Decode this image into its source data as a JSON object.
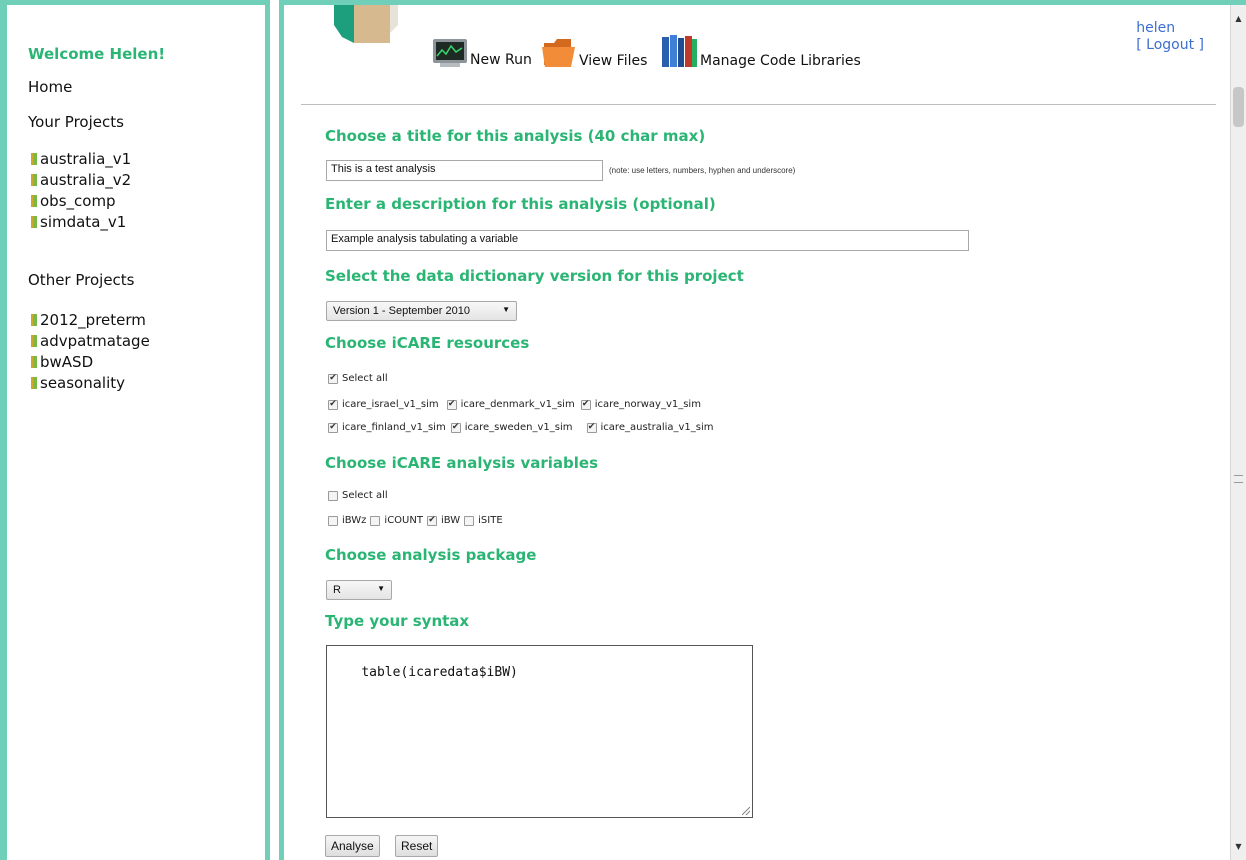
{
  "sidebar": {
    "welcome": "Welcome Helen!",
    "home": "Home",
    "your_projects_heading": "Your Projects",
    "your_projects": [
      "australia_v1",
      "australia_v2",
      "obs_comp",
      "simdata_v1"
    ],
    "other_projects_heading": "Other Projects",
    "other_projects": [
      "2012_preterm",
      "advpatmatage",
      "bwASD",
      "seasonality"
    ]
  },
  "toolbar": {
    "new_run": "New Run",
    "view_files": "View Files",
    "manage_code_libraries": "Manage Code Libraries"
  },
  "user": {
    "name": "helen",
    "logout": "[ Logout ]"
  },
  "form": {
    "title_heading": "Choose a title for this analysis (40 char max)",
    "title_value": "This is a test analysis",
    "title_note": "(note: use letters, numbers, hyphen and underscore)",
    "description_heading": "Enter a description for this analysis (optional)",
    "description_value": "Example analysis tabulating a variable",
    "dictionary_heading": "Select the data dictionary version for this project",
    "dictionary_value": "Version 1 - September 2010",
    "resources_heading": "Choose iCARE resources",
    "resources_select_all": {
      "label": "Select all",
      "checked": true
    },
    "resources": [
      {
        "label": "icare_israel_v1_sim",
        "checked": true
      },
      {
        "label": "icare_denmark_v1_sim",
        "checked": true
      },
      {
        "label": "icare_norway_v1_sim",
        "checked": true
      },
      {
        "label": "icare_finland_v1_sim",
        "checked": true
      },
      {
        "label": "icare_sweden_v1_sim",
        "checked": true
      },
      {
        "label": "icare_australia_v1_sim",
        "checked": true
      }
    ],
    "variables_heading": "Choose iCARE analysis variables",
    "variables_select_all": {
      "label": "Select all",
      "checked": false
    },
    "variables": [
      {
        "label": "iBWz",
        "checked": false
      },
      {
        "label": "iCOUNT",
        "checked": false
      },
      {
        "label": "iBW",
        "checked": true
      },
      {
        "label": "iSITE",
        "checked": false
      }
    ],
    "package_heading": "Choose analysis package",
    "package_value": "R",
    "syntax_heading": "Type your syntax",
    "syntax_value": "table(icaredata$iBW)",
    "analyse_button": "Analyse",
    "reset_button": "Reset"
  },
  "colors": {
    "accent": "#6fcfb9",
    "heading": "#2bb574",
    "link": "#3b6fd1"
  },
  "icons": [
    "monitor-icon",
    "folder-icon",
    "books-icon",
    "project-book-icon",
    "checkbox-icon",
    "dropdown-arrow-icon"
  ]
}
